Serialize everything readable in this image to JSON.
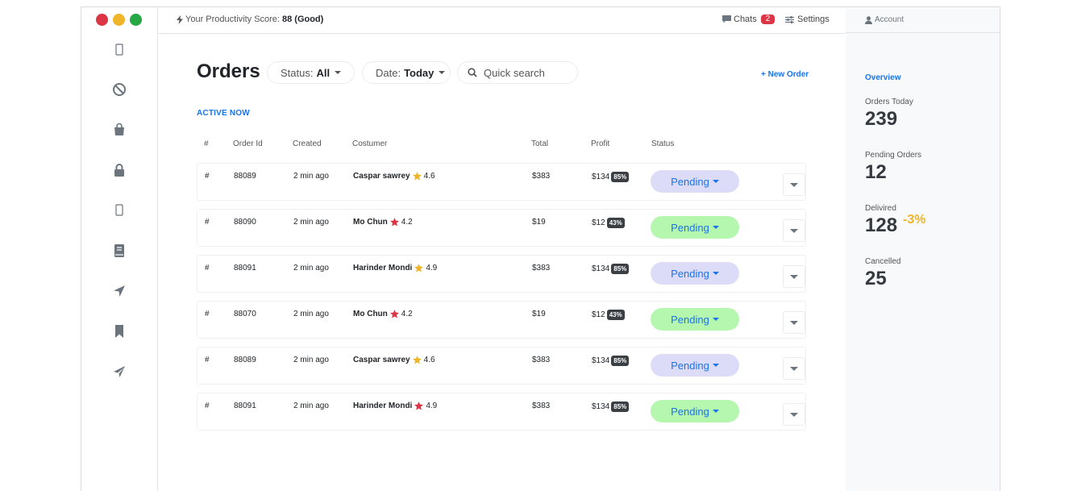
{
  "window_controls": {
    "close_color": "#dc3545",
    "minimize_color": "#f0b429",
    "maximize_color": "#28a745"
  },
  "sidebar": {
    "icons": [
      "mobile-icon",
      "ban-icon",
      "shopping-bag-icon",
      "lock-icon",
      "mobile-icon",
      "book-icon",
      "location-arrow-icon",
      "bookmark-icon",
      "paper-plane-icon"
    ]
  },
  "topbar": {
    "score_label": "Your Productivity Score:",
    "score_value": "88 (Good)",
    "chats_label": "Chats",
    "chats_count": "2",
    "settings_label": "Settings"
  },
  "orders": {
    "title": "Orders",
    "status_filter": {
      "label": "Status:",
      "value": "All"
    },
    "date_filter": {
      "label": "Date:",
      "value": "Today"
    },
    "search_placeholder": "Quick search",
    "new_order_label": "+ New Order",
    "section_label": "ACTIVE NOW",
    "columns": [
      "#",
      "Order Id",
      "Created",
      "Costumer",
      "Total",
      "Profit",
      "Status"
    ],
    "rows": [
      {
        "hash": "#",
        "order_id": "88089",
        "created": "2 min ago",
        "customer": "Caspar sawrey",
        "rating": "4.6",
        "star_color": "#f0b429",
        "total": "$383",
        "profit": "$134",
        "profit_pct": "85%",
        "status": "Pending",
        "status_bg": "#dcdcf9"
      },
      {
        "hash": "#",
        "order_id": "88090",
        "created": "2 min ago",
        "customer": "Mo Chun",
        "rating": "4.2",
        "star_color": "#dc3545",
        "total": "$19",
        "profit": "$12",
        "profit_pct": "43%",
        "status": "Pending",
        "status_bg": "#b6f7b0"
      },
      {
        "hash": "#",
        "order_id": "88091",
        "created": "2 min ago",
        "customer": "Harinder Mondi",
        "rating": "4.9",
        "star_color": "#f0b429",
        "total": "$383",
        "profit": "$134",
        "profit_pct": "85%",
        "status": "Pending",
        "status_bg": "#dcdcf9"
      },
      {
        "hash": "#",
        "order_id": "88070",
        "created": "2 min ago",
        "customer": "Mo Chun",
        "rating": "4.2",
        "star_color": "#dc3545",
        "total": "$19",
        "profit": "$12",
        "profit_pct": "43%",
        "status": "Pending",
        "status_bg": "#b6f7b0"
      },
      {
        "hash": "#",
        "order_id": "88089",
        "created": "2 min ago",
        "customer": "Caspar sawrey",
        "rating": "4.6",
        "star_color": "#f0b429",
        "total": "$383",
        "profit": "$134",
        "profit_pct": "85%",
        "status": "Pending",
        "status_bg": "#dcdcf9"
      },
      {
        "hash": "#",
        "order_id": "88091",
        "created": "2 min ago",
        "customer": "Harinder Mondi",
        "rating": "4.9",
        "star_color": "#dc3545",
        "total": "$383",
        "profit": "$134",
        "profit_pct": "85%",
        "status": "Pending",
        "status_bg": "#b6f7b0"
      }
    ]
  },
  "right_panel": {
    "account_label": "Account",
    "overview_label": "Overview",
    "stats": [
      {
        "label": "Orders Today",
        "value": "239",
        "change": ""
      },
      {
        "label": "Pending Orders",
        "value": "12",
        "change": ""
      },
      {
        "label": "Delivired",
        "value": "128",
        "change": "-3%"
      },
      {
        "label": "Cancelled",
        "value": "25",
        "change": ""
      }
    ]
  },
  "colors": {
    "accent": "#1a73e8",
    "badge_dark": "#3a3f44"
  }
}
